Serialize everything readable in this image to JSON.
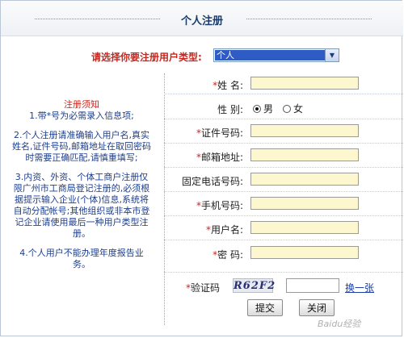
{
  "header": {
    "title": "个人注册"
  },
  "type_select": {
    "label": "请选择你要注册用户类型:",
    "value": "个人"
  },
  "notes": {
    "title": "注册须知",
    "items": [
      "1.带*号为必需录入信息项;",
      "2.个人注册请准确输入用户名,真实姓名,证件号码,邮箱地址在取回密码时需要正确匹配,请慎重填写;",
      "3.内资、外资、个体工商户注册仅限广州市工商局登记注册的,必须根据提示输入企业(个体)信息,系统将自动分配帐号;其他组织或非本市登记企业请使用最后一种用户类型注册。",
      "4.个人用户不能办理年度报告业务。"
    ]
  },
  "fields": {
    "name": {
      "star": "*",
      "label": "姓 名:"
    },
    "gender": {
      "label": "性 别:",
      "options": [
        "男",
        "女"
      ],
      "selected": "男"
    },
    "id_number": {
      "star": "*",
      "label": "证件号码:"
    },
    "email": {
      "star": "*",
      "label": "邮箱地址:"
    },
    "landline": {
      "label": "固定电话号码:"
    },
    "mobile": {
      "star": "*",
      "label": "手机号码:"
    },
    "username": {
      "star": "*",
      "label": "用户名:"
    },
    "password": {
      "star": "*",
      "label": "密 码:"
    }
  },
  "captcha": {
    "star": "*",
    "label": "验证码",
    "code": "R62F2",
    "refresh_label": "换一张"
  },
  "buttons": {
    "submit": "提交",
    "close": "关闭"
  },
  "watermark": "Baidu经验"
}
